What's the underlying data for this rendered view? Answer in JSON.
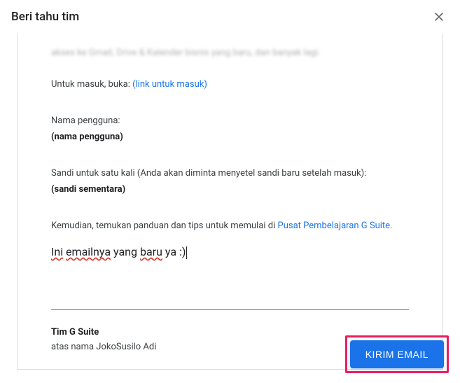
{
  "header": {
    "title": "Beri tahu tim"
  },
  "body": {
    "partial": "akses ke Gmail, Drive & Kalender bisnis yang baru, dan banyak lagi.",
    "login_prompt": "Untuk masuk, buka: ",
    "login_link": "(link untuk masuk)",
    "username_label": "Nama pengguna:",
    "username_value": "(nama pengguna)",
    "password_label": "Sandi untuk satu kali (Anda akan diminta menyetel sandi baru setelah masuk):",
    "password_value": "(sandi sementara)",
    "guide_text": "Kemudian, temukan panduan dan tips untuk memulai di ",
    "guide_link": "Pusat Pembelajaran G Suite.",
    "editable_word1": "Ini",
    "editable_word2": "emailnya",
    "editable_word3": "yang",
    "editable_word4": "baru",
    "editable_word5": "ya :)",
    "signature_team": "Tim G Suite",
    "signature_behalf": "atas nama JokoSusilo Adi"
  },
  "actions": {
    "send": "KIRIM EMAIL"
  }
}
